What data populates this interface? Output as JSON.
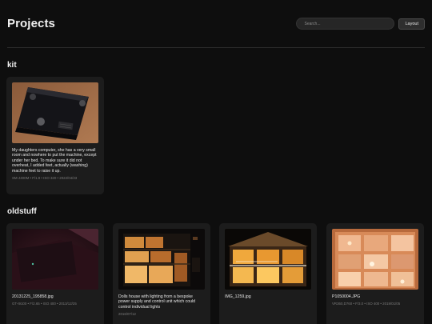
{
  "header": {
    "title": "Projects",
    "search_placeholder": "Search...",
    "layout_label": "Layout"
  },
  "sections": [
    {
      "title": "kit",
      "cards": [
        {
          "caption": "My daughters computer, she has a very small room and nowhere to put the machine, except under her bed. To make sure it did not overheat, I added feet, actually (washing) machine feet to raise it up.",
          "meta": "SM-J400M • F/1.9 • ISO 320 • 2022/04/23"
        }
      ]
    },
    {
      "title": "oldstuff",
      "cards": [
        {
          "caption": "20131225_195858.jpg",
          "meta": "GT-I9100 • F/2.65 • ISO 400 • 2013/12/25"
        },
        {
          "caption": "Dolls house with lighting from a bespoke power supply and control unit which could control individual lights",
          "meta": "2016/07/12"
        },
        {
          "caption": "IMG_1259.jpg",
          "meta": ""
        },
        {
          "caption": "P1050004.JPG",
          "meta": "VR360,D760 • F/3.0 • ISO 400 • 2019/01/05"
        }
      ]
    }
  ],
  "colors": {
    "background": "#0e0e0e",
    "card": "#1c1c1c",
    "meta_text": "#7a7a7a"
  }
}
